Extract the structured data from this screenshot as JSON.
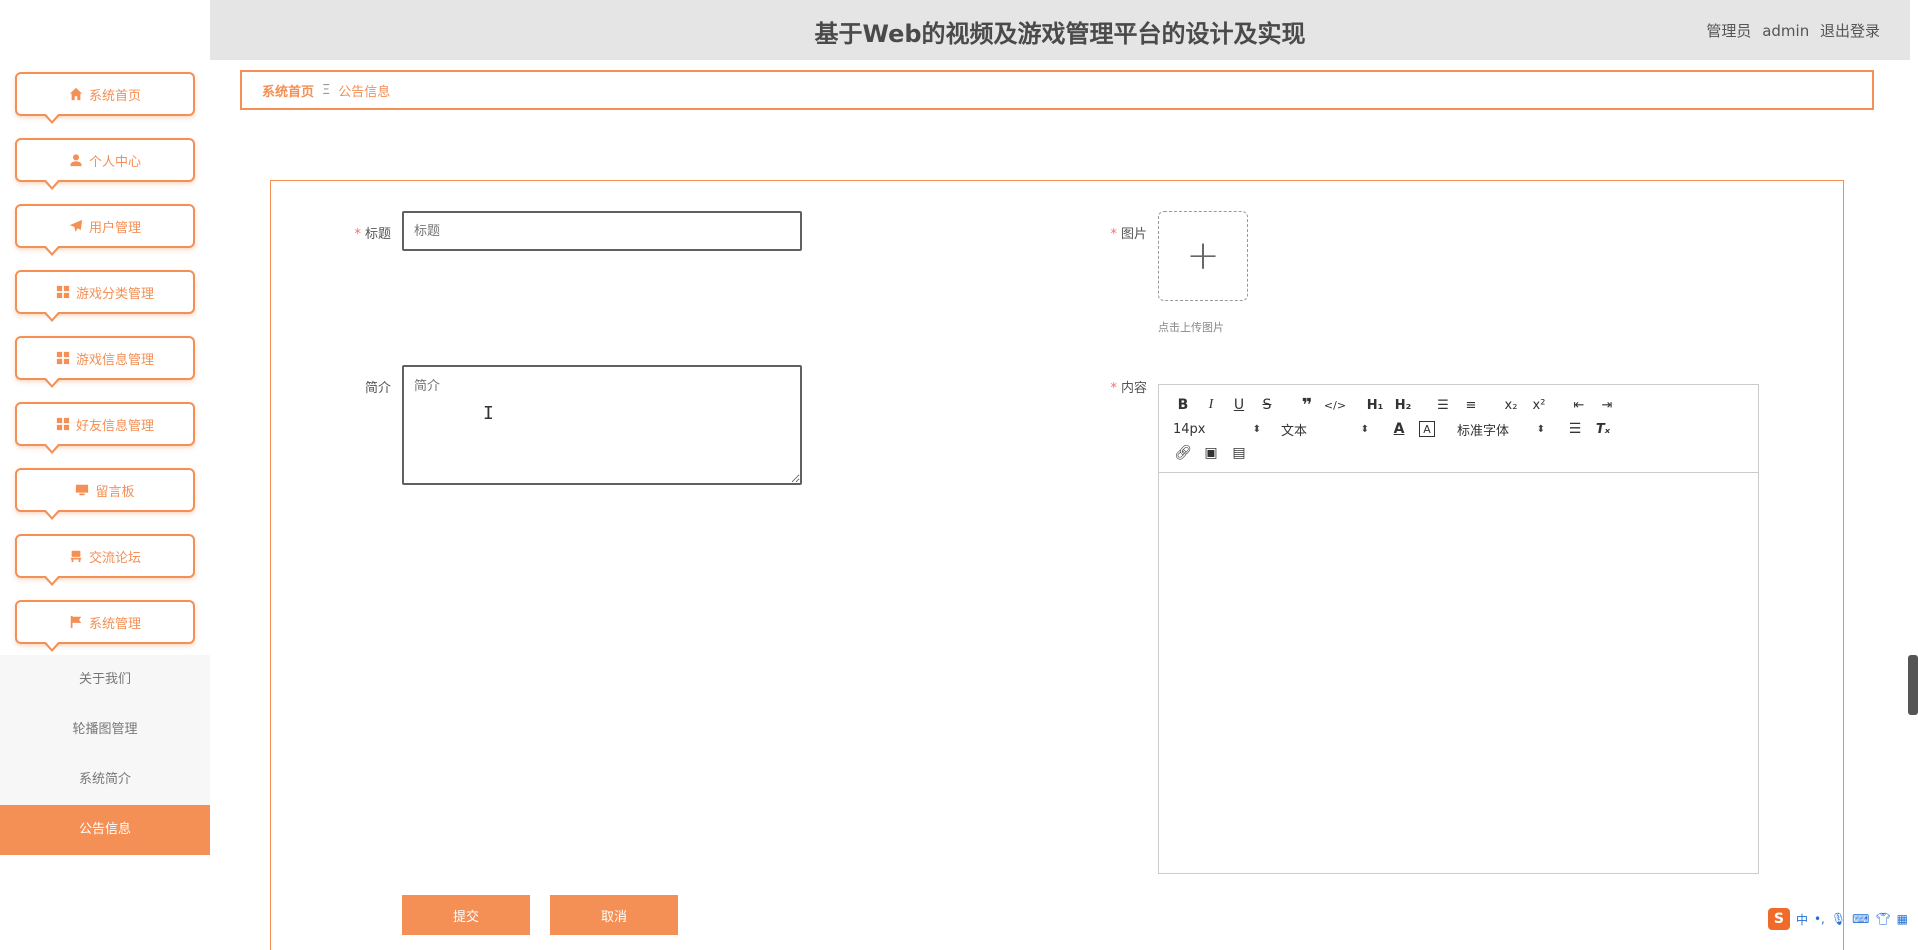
{
  "header": {
    "title": "基于Web的视频及游戏管理平台的设计及实现",
    "role": "管理员",
    "username": "admin",
    "logout": "退出登录"
  },
  "sidebar": {
    "items": [
      {
        "label": "系统首页",
        "icon": "home-icon"
      },
      {
        "label": "个人中心",
        "icon": "user-icon"
      },
      {
        "label": "用户管理",
        "icon": "paper-plane-icon"
      },
      {
        "label": "游戏分类管理",
        "icon": "grid-icon"
      },
      {
        "label": "游戏信息管理",
        "icon": "grid-icon"
      },
      {
        "label": "好友信息管理",
        "icon": "grid-icon"
      },
      {
        "label": "留言板",
        "icon": "monitor-icon"
      },
      {
        "label": "交流论坛",
        "icon": "chair-icon"
      },
      {
        "label": "系统管理",
        "icon": "flag-icon"
      }
    ],
    "submenu": [
      {
        "label": "关于我们"
      },
      {
        "label": "轮播图管理"
      },
      {
        "label": "系统简介"
      },
      {
        "label": "公告信息",
        "active": true
      }
    ]
  },
  "breadcrumb": {
    "home": "系统首页",
    "separator": "Ξ",
    "current": "公告信息"
  },
  "form": {
    "title_label": "标题",
    "title_placeholder": "标题",
    "intro_label": "简介",
    "intro_placeholder": "简介",
    "image_label": "图片",
    "upload_tip": "点击上传图片",
    "content_label": "内容",
    "required_mark": "*",
    "submit": "提交",
    "cancel": "取消"
  },
  "editor": {
    "font_size": "14px",
    "block_type": "文本",
    "font_family": "标准字体"
  },
  "colors": {
    "accent": "#f48f55",
    "header_bg": "#e5e5e5",
    "required": "#f56c6c"
  }
}
